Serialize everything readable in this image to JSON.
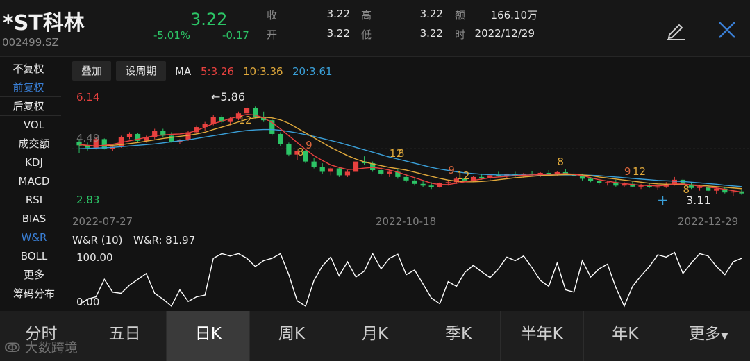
{
  "header": {
    "name": "*ST科林",
    "code": "002499.SZ",
    "price": "3.22",
    "change_pct": "-5.01%",
    "change": "-0.17",
    "quote": [
      {
        "label": "收",
        "value": "3.22"
      },
      {
        "label": "高",
        "value": "3.22"
      },
      {
        "label": "额",
        "value": "166.10万"
      },
      {
        "label": "开",
        "value": "3.22"
      },
      {
        "label": "低",
        "value": "3.22"
      },
      {
        "label": "时",
        "value": "2022/12/29"
      }
    ],
    "icons": [
      "edit-icon",
      "close-icon"
    ]
  },
  "left_menu": {
    "adjust": [
      "不复权",
      "前复权",
      "后复权"
    ],
    "active_adjust": "前复权",
    "indicators": [
      "VOL",
      "成交额",
      "KDJ",
      "MACD",
      "RSI",
      "BIAS",
      "W&R",
      "BOLL",
      "更多",
      "筹码分布"
    ],
    "active_indicator": "W&R"
  },
  "toolbar": {
    "overlay": "叠加",
    "period": "设周期",
    "ma_label": "MA",
    "ma5": "5:3.26",
    "ma10": "10:3.36",
    "ma20": "20:3.61"
  },
  "colors": {
    "up": "#e8413f",
    "down": "#2cc466",
    "ma5": "#e8413f",
    "ma10": "#e0a93b",
    "ma20": "#3aa0d9",
    "wr_line": "#ffffff",
    "active_blue": "#3a7fd5"
  },
  "chart_data": {
    "type": "candlestick",
    "price_range": [
      2.83,
      6.14
    ],
    "y_labels": {
      "top": "6.14",
      "bottom": "2.83",
      "left_mark": "4.49"
    },
    "dates": {
      "start": "2022-07-27",
      "mid": "2022-10-18",
      "end": "2022-12-29"
    },
    "high_marker": "5.86",
    "low_marker": "3.11",
    "tags": [
      "12",
      "8",
      "9",
      "12",
      "8",
      "9",
      "12",
      "8",
      "9",
      "12",
      "8"
    ],
    "candles": [
      [
        4.72,
        4.8,
        4.4,
        4.62
      ],
      [
        4.62,
        4.7,
        4.47,
        4.55
      ],
      [
        4.55,
        4.85,
        4.5,
        4.8
      ],
      [
        4.8,
        4.82,
        4.5,
        4.52
      ],
      [
        4.52,
        4.6,
        4.45,
        4.58
      ],
      [
        4.58,
        4.9,
        4.55,
        4.86
      ],
      [
        4.86,
        5.0,
        4.8,
        4.95
      ],
      [
        4.95,
        4.97,
        4.7,
        4.75
      ],
      [
        4.75,
        4.9,
        4.7,
        4.85
      ],
      [
        4.85,
        5.1,
        4.8,
        5.05
      ],
      [
        5.05,
        5.1,
        4.85,
        4.9
      ],
      [
        4.9,
        5.0,
        4.7,
        4.72
      ],
      [
        4.72,
        4.8,
        4.65,
        4.78
      ],
      [
        4.78,
        5.05,
        4.75,
        5.0
      ],
      [
        5.0,
        5.2,
        4.95,
        5.15
      ],
      [
        5.15,
        5.3,
        5.05,
        5.25
      ],
      [
        5.25,
        5.5,
        5.2,
        5.45
      ],
      [
        5.45,
        5.5,
        5.25,
        5.3
      ],
      [
        5.3,
        5.45,
        5.2,
        5.4
      ],
      [
        5.4,
        5.6,
        5.35,
        5.55
      ],
      [
        5.55,
        5.86,
        5.5,
        5.7
      ],
      [
        5.7,
        5.75,
        5.4,
        5.45
      ],
      [
        5.45,
        5.6,
        5.3,
        5.35
      ],
      [
        5.35,
        5.4,
        4.9,
        4.95
      ],
      [
        4.95,
        5.0,
        4.6,
        4.65
      ],
      [
        4.65,
        4.7,
        4.3,
        4.35
      ],
      [
        4.35,
        4.5,
        4.2,
        4.45
      ],
      [
        4.45,
        4.5,
        4.1,
        4.15
      ],
      [
        4.15,
        4.25,
        3.95,
        4.0
      ],
      [
        4.0,
        4.1,
        3.8,
        3.85
      ],
      [
        3.85,
        4.0,
        3.75,
        3.95
      ],
      [
        3.95,
        4.0,
        3.7,
        3.75
      ],
      [
        3.75,
        3.9,
        3.7,
        3.85
      ],
      [
        3.85,
        4.2,
        3.8,
        4.15
      ],
      [
        4.15,
        4.3,
        4.05,
        4.1
      ],
      [
        4.1,
        4.15,
        3.85,
        3.9
      ],
      [
        3.9,
        4.0,
        3.75,
        3.8
      ],
      [
        3.8,
        3.9,
        3.7,
        3.85
      ],
      [
        3.85,
        3.95,
        3.65,
        3.7
      ],
      [
        3.7,
        3.8,
        3.55,
        3.6
      ],
      [
        3.6,
        3.7,
        3.45,
        3.5
      ],
      [
        3.5,
        3.6,
        3.4,
        3.45
      ],
      [
        3.45,
        3.55,
        3.35,
        3.4
      ],
      [
        3.4,
        3.55,
        3.38,
        3.52
      ],
      [
        3.52,
        3.6,
        3.45,
        3.55
      ],
      [
        3.55,
        3.7,
        3.5,
        3.65
      ],
      [
        3.65,
        3.75,
        3.55,
        3.6
      ],
      [
        3.6,
        3.72,
        3.55,
        3.7
      ],
      [
        3.7,
        3.8,
        3.62,
        3.68
      ],
      [
        3.68,
        3.78,
        3.6,
        3.75
      ],
      [
        3.75,
        3.85,
        3.7,
        3.72
      ],
      [
        3.72,
        3.8,
        3.65,
        3.78
      ],
      [
        3.78,
        3.85,
        3.7,
        3.74
      ],
      [
        3.74,
        3.82,
        3.68,
        3.8
      ],
      [
        3.8,
        3.88,
        3.72,
        3.76
      ],
      [
        3.76,
        3.84,
        3.7,
        3.82
      ],
      [
        3.82,
        3.9,
        3.75,
        3.78
      ],
      [
        3.78,
        3.86,
        3.72,
        3.84
      ],
      [
        3.84,
        3.92,
        3.78,
        3.8
      ],
      [
        3.8,
        3.85,
        3.7,
        3.72
      ],
      [
        3.72,
        3.8,
        3.6,
        3.65
      ],
      [
        3.65,
        3.7,
        3.55,
        3.58
      ],
      [
        3.58,
        3.65,
        3.48,
        3.52
      ],
      [
        3.52,
        3.6,
        3.45,
        3.55
      ],
      [
        3.55,
        3.62,
        3.42,
        3.45
      ],
      [
        3.45,
        3.55,
        3.4,
        3.5
      ],
      [
        3.5,
        3.58,
        3.4,
        3.42
      ],
      [
        3.42,
        3.5,
        3.35,
        3.45
      ],
      [
        3.45,
        3.52,
        3.38,
        3.4
      ],
      [
        3.4,
        3.48,
        3.32,
        3.42
      ],
      [
        3.42,
        3.55,
        3.38,
        3.5
      ],
      [
        3.5,
        3.7,
        3.45,
        3.62
      ],
      [
        3.62,
        3.66,
        3.45,
        3.48
      ],
      [
        3.48,
        3.52,
        3.35,
        3.38
      ],
      [
        3.38,
        3.45,
        3.3,
        3.42
      ],
      [
        3.42,
        3.48,
        3.28,
        3.3
      ],
      [
        3.3,
        3.4,
        3.2,
        3.36
      ],
      [
        3.36,
        3.42,
        3.22,
        3.25
      ],
      [
        3.25,
        3.32,
        3.15,
        3.28
      ],
      [
        3.28,
        3.34,
        3.18,
        3.22
      ]
    ],
    "ma5": [
      4.65,
      4.62,
      4.6,
      4.62,
      4.65,
      4.7,
      4.75,
      4.8,
      4.85,
      4.9,
      4.92,
      4.94,
      4.95,
      4.98,
      5.05,
      5.15,
      5.25,
      5.32,
      5.4,
      5.46,
      5.52,
      5.5,
      5.42,
      5.28,
      5.1,
      4.9,
      4.7,
      4.5,
      4.32,
      4.18,
      4.05,
      3.98,
      3.92,
      3.93,
      3.96,
      3.98,
      3.95,
      3.9,
      3.84,
      3.76,
      3.68,
      3.6,
      3.52,
      3.48,
      3.48,
      3.52,
      3.56,
      3.6,
      3.64,
      3.68,
      3.7,
      3.72,
      3.74,
      3.75,
      3.76,
      3.77,
      3.78,
      3.79,
      3.8,
      3.78,
      3.74,
      3.68,
      3.62,
      3.58,
      3.54,
      3.51,
      3.48,
      3.46,
      3.45,
      3.44,
      3.46,
      3.5,
      3.5,
      3.47,
      3.43,
      3.4,
      3.38,
      3.34,
      3.3,
      3.26
    ],
    "ma10": [
      4.6,
      4.6,
      4.6,
      4.61,
      4.62,
      4.64,
      4.67,
      4.7,
      4.74,
      4.78,
      4.82,
      4.85,
      4.88,
      4.91,
      4.95,
      5.0,
      5.08,
      5.15,
      5.22,
      5.3,
      5.38,
      5.42,
      5.44,
      5.42,
      5.36,
      5.26,
      5.12,
      4.98,
      4.84,
      4.7,
      4.56,
      4.44,
      4.32,
      4.22,
      4.14,
      4.08,
      4.03,
      3.98,
      3.94,
      3.9,
      3.84,
      3.78,
      3.72,
      3.66,
      3.61,
      3.58,
      3.56,
      3.56,
      3.57,
      3.59,
      3.62,
      3.65,
      3.68,
      3.7,
      3.72,
      3.74,
      3.75,
      3.76,
      3.77,
      3.77,
      3.76,
      3.74,
      3.7,
      3.67,
      3.64,
      3.61,
      3.58,
      3.55,
      3.52,
      3.5,
      3.49,
      3.49,
      3.48,
      3.47,
      3.46,
      3.44,
      3.42,
      3.4,
      3.38,
      3.36
    ],
    "ma20": [
      4.52,
      4.53,
      4.54,
      4.55,
      4.56,
      4.58,
      4.6,
      4.62,
      4.64,
      4.66,
      4.69,
      4.72,
      4.75,
      4.78,
      4.82,
      4.86,
      4.9,
      4.94,
      4.98,
      5.02,
      5.05,
      5.07,
      5.08,
      5.08,
      5.06,
      5.02,
      4.98,
      4.93,
      4.88,
      4.82,
      4.76,
      4.7,
      4.63,
      4.56,
      4.49,
      4.42,
      4.35,
      4.28,
      4.22,
      4.16,
      4.1,
      4.04,
      3.98,
      3.93,
      3.89,
      3.85,
      3.82,
      3.8,
      3.78,
      3.77,
      3.76,
      3.76,
      3.76,
      3.76,
      3.76,
      3.76,
      3.76,
      3.76,
      3.76,
      3.76,
      3.76,
      3.75,
      3.74,
      3.72,
      3.7,
      3.68,
      3.66,
      3.64,
      3.62,
      3.6,
      3.59,
      3.58,
      3.57,
      3.55,
      3.53,
      3.51,
      3.49,
      3.46,
      3.44,
      3.42
    ]
  },
  "wr": {
    "title": "W&R (10)",
    "value_label": "W&R: 81.97",
    "top_label": "100.00",
    "bottom_label": "0.00",
    "values": [
      8,
      18,
      22,
      52,
      30,
      28,
      42,
      52,
      62,
      28,
      18,
      6,
      34,
      14,
      22,
      25,
      88,
      96,
      92,
      96,
      88,
      74,
      84,
      88,
      96,
      60,
      15,
      6,
      50,
      75,
      90,
      58,
      82,
      56,
      66,
      96,
      70,
      88,
      95,
      60,
      68,
      44,
      20,
      10,
      48,
      40,
      64,
      76,
      65,
      55,
      70,
      90,
      84,
      92,
      72,
      50,
      40,
      80,
      34,
      30,
      84,
      56,
      70,
      78,
      38,
      6,
      40,
      58,
      74,
      94,
      90,
      98,
      62,
      80,
      96,
      92,
      74,
      60,
      82,
      88
    ]
  },
  "tabs": [
    "分时",
    "五日",
    "日K",
    "周K",
    "月K",
    "季K",
    "半年K",
    "年K",
    "更多"
  ],
  "active_tab": "日K",
  "watermark": "大数跨境"
}
